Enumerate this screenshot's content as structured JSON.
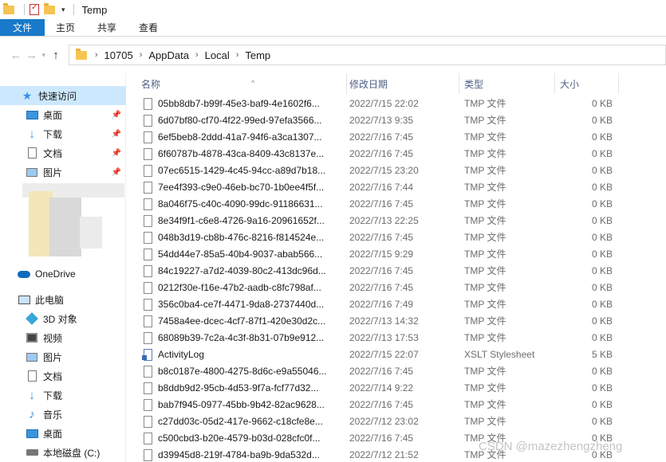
{
  "window": {
    "title": "Temp"
  },
  "ribbon": {
    "tabs": [
      "文件",
      "主页",
      "共享",
      "查看"
    ]
  },
  "address": {
    "crumbs": [
      "10705",
      "AppData",
      "Local",
      "Temp"
    ]
  },
  "sidebar": {
    "quick_access": "快速访问",
    "pinned": [
      {
        "label": "桌面",
        "icon": "desktop-icon"
      },
      {
        "label": "下载",
        "icon": "download-icon"
      },
      {
        "label": "文档",
        "icon": "document-icon"
      },
      {
        "label": "图片",
        "icon": "picture-icon"
      }
    ],
    "onedrive": "OneDrive",
    "this_pc": "此电脑",
    "pc_items": [
      {
        "label": "3D 对象",
        "icon": "3d-objects-icon"
      },
      {
        "label": "视频",
        "icon": "video-icon"
      },
      {
        "label": "图片",
        "icon": "picture-icon"
      },
      {
        "label": "文档",
        "icon": "document-icon"
      },
      {
        "label": "下载",
        "icon": "download-icon"
      },
      {
        "label": "音乐",
        "icon": "music-icon"
      },
      {
        "label": "桌面",
        "icon": "desktop-icon"
      },
      {
        "label": "本地磁盘 (C:)",
        "icon": "drive-icon"
      }
    ]
  },
  "columns": {
    "name": "名称",
    "date": "修改日期",
    "type": "类型",
    "size": "大小"
  },
  "files": [
    {
      "name": "05bb8db7-b99f-45e3-baf9-4e1602f6...",
      "date": "2022/7/15 22:02",
      "type": "TMP 文件",
      "size": "0 KB",
      "icon": "file-icon"
    },
    {
      "name": "6d07bf80-cf70-4f22-99ed-97efa3566...",
      "date": "2022/7/13 9:35",
      "type": "TMP 文件",
      "size": "0 KB",
      "icon": "file-icon"
    },
    {
      "name": "6ef5beb8-2ddd-41a7-94f6-a3ca1307...",
      "date": "2022/7/16 7:45",
      "type": "TMP 文件",
      "size": "0 KB",
      "icon": "file-icon"
    },
    {
      "name": "6f60787b-4878-43ca-8409-43c8137e...",
      "date": "2022/7/16 7:45",
      "type": "TMP 文件",
      "size": "0 KB",
      "icon": "file-icon"
    },
    {
      "name": "07ec6515-1429-4c45-94cc-a89d7b18...",
      "date": "2022/7/15 23:20",
      "type": "TMP 文件",
      "size": "0 KB",
      "icon": "file-icon"
    },
    {
      "name": "7ee4f393-c9e0-46eb-bc70-1b0ee4f5f...",
      "date": "2022/7/16 7:44",
      "type": "TMP 文件",
      "size": "0 KB",
      "icon": "file-icon"
    },
    {
      "name": "8a046f75-c40c-4090-99dc-91186631...",
      "date": "2022/7/16 7:45",
      "type": "TMP 文件",
      "size": "0 KB",
      "icon": "file-icon"
    },
    {
      "name": "8e34f9f1-c6e8-4726-9a16-20961652f...",
      "date": "2022/7/13 22:25",
      "type": "TMP 文件",
      "size": "0 KB",
      "icon": "file-icon"
    },
    {
      "name": "048b3d19-cb8b-476c-8216-f814524e...",
      "date": "2022/7/16 7:45",
      "type": "TMP 文件",
      "size": "0 KB",
      "icon": "file-icon"
    },
    {
      "name": "54dd44e7-85a5-40b4-9037-abab566...",
      "date": "2022/7/15 9:29",
      "type": "TMP 文件",
      "size": "0 KB",
      "icon": "file-icon"
    },
    {
      "name": "84c19227-a7d2-4039-80c2-413dc96d...",
      "date": "2022/7/16 7:45",
      "type": "TMP 文件",
      "size": "0 KB",
      "icon": "file-icon"
    },
    {
      "name": "0212f30e-f16e-47b2-aadb-c8fc798af...",
      "date": "2022/7/16 7:45",
      "type": "TMP 文件",
      "size": "0 KB",
      "icon": "file-icon"
    },
    {
      "name": "356c0ba4-ce7f-4471-9da8-2737440d...",
      "date": "2022/7/16 7:49",
      "type": "TMP 文件",
      "size": "0 KB",
      "icon": "file-icon"
    },
    {
      "name": "7458a4ee-dcec-4cf7-87f1-420e30d2c...",
      "date": "2022/7/13 14:32",
      "type": "TMP 文件",
      "size": "0 KB",
      "icon": "file-icon"
    },
    {
      "name": "68089b39-7c2a-4c3f-8b31-07b9e912...",
      "date": "2022/7/13 17:53",
      "type": "TMP 文件",
      "size": "0 KB",
      "icon": "file-icon"
    },
    {
      "name": "ActivityLog",
      "date": "2022/7/15 22:07",
      "type": "XSLT Stylesheet",
      "size": "5 KB",
      "icon": "xslt-file-icon"
    },
    {
      "name": "b8c0187e-4800-4275-8d6c-e9a55046...",
      "date": "2022/7/16 7:45",
      "type": "TMP 文件",
      "size": "0 KB",
      "icon": "file-icon"
    },
    {
      "name": "b8ddb9d2-95cb-4d53-9f7a-fcf77d32...",
      "date": "2022/7/14 9:22",
      "type": "TMP 文件",
      "size": "0 KB",
      "icon": "file-icon"
    },
    {
      "name": "bab7f945-0977-45bb-9b42-82ac9628...",
      "date": "2022/7/16 7:45",
      "type": "TMP 文件",
      "size": "0 KB",
      "icon": "file-icon"
    },
    {
      "name": "c27dd03c-05d2-417e-9662-c18cfe8e...",
      "date": "2022/7/12 23:02",
      "type": "TMP 文件",
      "size": "0 KB",
      "icon": "file-icon"
    },
    {
      "name": "c500cbd3-b20e-4579-b03d-028cfc0f...",
      "date": "2022/7/16 7:45",
      "type": "TMP 文件",
      "size": "0 KB",
      "icon": "file-icon"
    },
    {
      "name": "d39945d8-219f-4784-ba9b-9da532d...",
      "date": "2022/7/12 21:52",
      "type": "TMP 文件",
      "size": "0 KB",
      "icon": "file-icon"
    }
  ],
  "watermark": "CSDN @mazezhengzheng"
}
